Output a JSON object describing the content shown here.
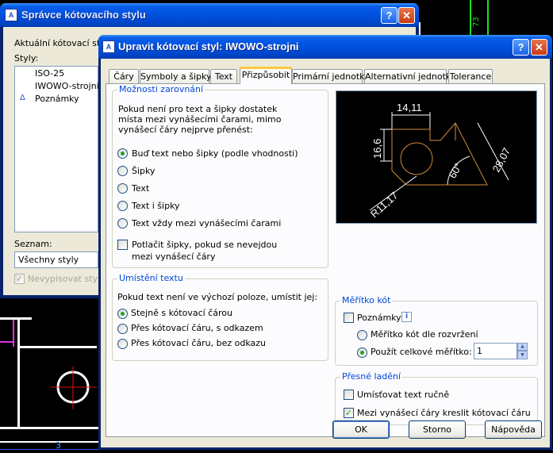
{
  "background": {
    "label_73": "73",
    "label_3": "3"
  },
  "back_dialog": {
    "title": "Správce kótovacího stylu",
    "current_style_label": "Aktuální kótovací styl",
    "styles_label": "Styly:",
    "styles": [
      "ISO-25",
      "IWOWO-strojni",
      "Poznámky"
    ],
    "list_label": "Seznam:",
    "list_value": "Všechny styly",
    "no_xref_label": "Nevypisovat styly X"
  },
  "dialog": {
    "title": "Upravit kótovací styl: IWOWO-strojni",
    "tabs": [
      "Čáry",
      "Symboly a šipky",
      "Text",
      "Přizpůsobit",
      "Primární jednotky",
      "Alternativní jednotky",
      "Tolerance"
    ],
    "fit_options": {
      "title": "Možnosti zarovnání",
      "description": "Pokud není pro text a šipky dostatek místa mezi vynášecími čarami, mimo vynášecí čáry nejprve přenést:",
      "options": [
        "Buď text nebo šipky (podle vhodnosti)",
        "Šipky",
        "Text",
        "Text i šipky",
        "Text vždy mezi vynášecími čarami"
      ],
      "selected_index": 0,
      "suppress_arrows": "Potlačit šipky, pokud se nevejdou mezi vynášecí čáry"
    },
    "text_placement": {
      "title": "Umístění textu",
      "description": "Pokud text není ve výchozí poloze, umístit jej:",
      "options": [
        "Stejně s kótovací čárou",
        "Přes kótovací čáru, s odkazem",
        "Přes kótovací čáru, bez odkazu"
      ],
      "selected_index": 0
    },
    "preview": {
      "dim_top": "14,11",
      "dim_left": "16,6",
      "dim_right": "28,07",
      "dim_angle": "60°",
      "dim_radius": "R11,17"
    },
    "scale": {
      "title": "Měřítko kót",
      "annotative": "Poznámky",
      "scale_to_layout": "Měřítko kót dle rozvržení",
      "overall_scale": "Použít celkové měřítko:",
      "overall_value": "1"
    },
    "fine_tuning": {
      "title": "Přesné ladění",
      "manual_text": "Umísťovat text ručně",
      "draw_dim_line": "Mezi vynášecí čáry kreslit kótovací čáru"
    },
    "buttons": {
      "ok": "OK",
      "cancel": "Storno",
      "help": "Nápověda"
    }
  }
}
